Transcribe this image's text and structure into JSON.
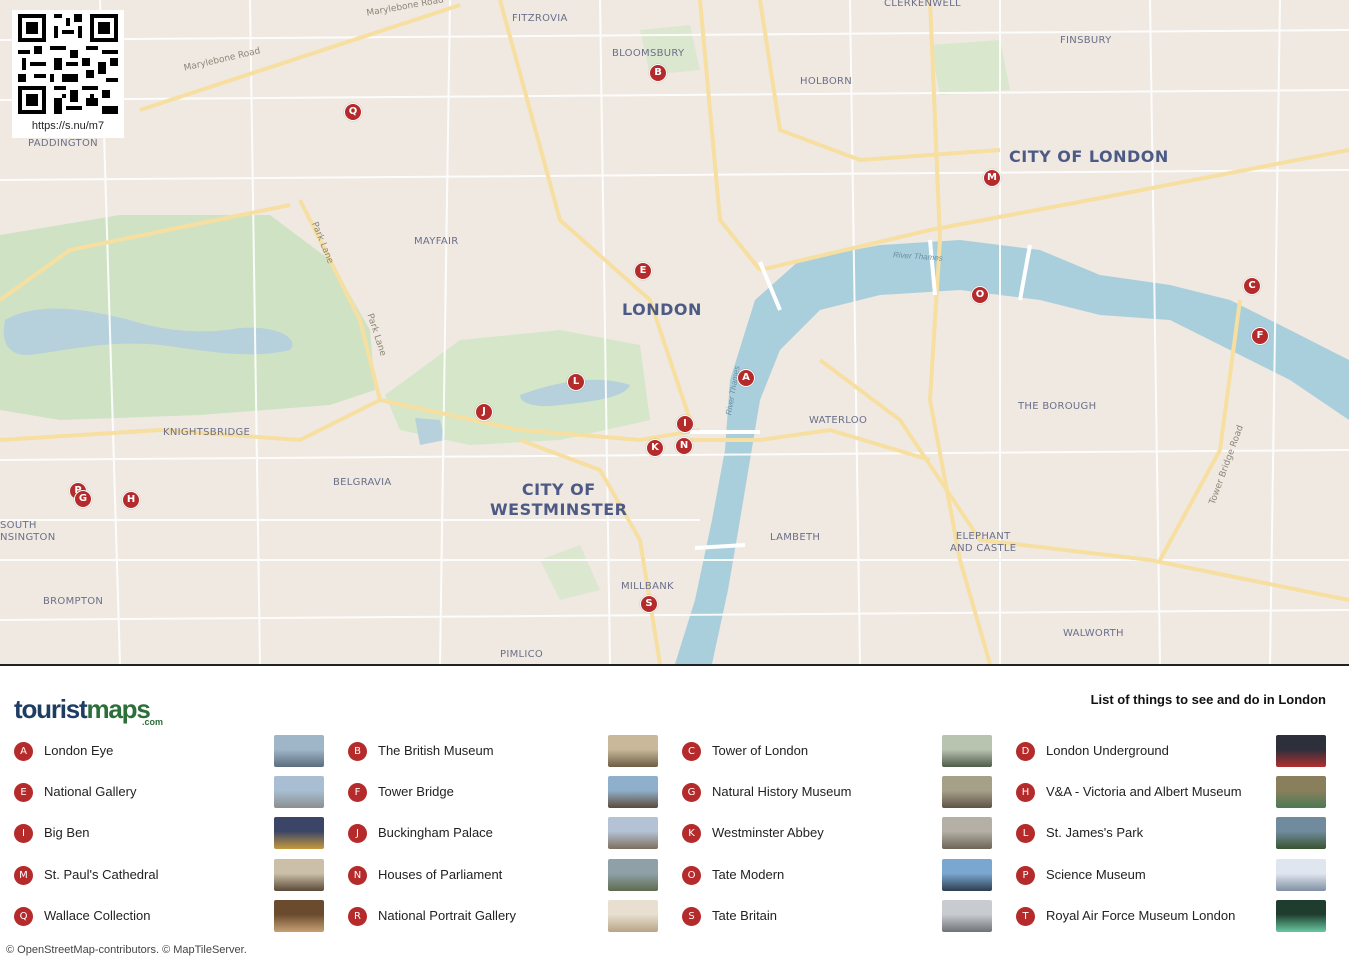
{
  "map": {
    "qr_url": "https://s.nu/m7",
    "area_labels": [
      {
        "id": "fitzrovia",
        "text": "FITZROVIA"
      },
      {
        "id": "clerkenwell",
        "text": "CLERKENWELL"
      },
      {
        "id": "finsbury",
        "text": "FINSBURY"
      },
      {
        "id": "bloomsbury",
        "text": "BLOOMSBURY"
      },
      {
        "id": "holborn",
        "text": "HOLBORN"
      },
      {
        "id": "paddington",
        "text": "PADDINGTON"
      },
      {
        "id": "mayfair",
        "text": "MAYFAIR"
      },
      {
        "id": "knightsbridge",
        "text": "KNIGHTSBRIDGE"
      },
      {
        "id": "belgravia",
        "text": "BELGRAVIA"
      },
      {
        "id": "waterloo",
        "text": "WATERLOO"
      },
      {
        "id": "the-borough",
        "text": "THE BOROUGH"
      },
      {
        "id": "lambeth",
        "text": "LAMBETH"
      },
      {
        "id": "millbank",
        "text": "MILLBANK"
      },
      {
        "id": "brompton",
        "text": "BROMPTON"
      },
      {
        "id": "pimlico",
        "text": "PIMLICO"
      },
      {
        "id": "walworth",
        "text": "WALWORTH"
      },
      {
        "id": "south-kensington",
        "text": "SOUTH\nNSINGTON"
      },
      {
        "id": "elephant-castle",
        "text": "ELEPHANT\nAND CASTLE"
      }
    ],
    "major_labels": [
      {
        "id": "london",
        "text": "LONDON"
      },
      {
        "id": "city-of-london",
        "text": "CITY OF LONDON"
      },
      {
        "id": "city-of-westminster",
        "text": "CITY OF\nWESTMINSTER"
      }
    ],
    "street_labels": [
      {
        "id": "marylebone-road-1",
        "text": "Marylebone Road"
      },
      {
        "id": "marylebone-road-2",
        "text": "Marylebone Road"
      },
      {
        "id": "park-lane-1",
        "text": "Park Lane"
      },
      {
        "id": "park-lane-2",
        "text": "Park Lane"
      },
      {
        "id": "tower-bridge-road",
        "text": "Tower Bridge Road"
      }
    ],
    "river_labels": [
      {
        "id": "river-thames-1",
        "text": "River Thames"
      },
      {
        "id": "river-thames-2",
        "text": "River Thames"
      }
    ],
    "pins": [
      "A",
      "B",
      "C",
      "E",
      "F",
      "G",
      "H",
      "I",
      "J",
      "K",
      "L",
      "M",
      "N",
      "O",
      "P",
      "Q",
      "S"
    ]
  },
  "legend": {
    "logo_part1": "tourist",
    "logo_part2": "maps",
    "logo_suffix": ".com",
    "title": "List of things to see and do in London",
    "items": [
      {
        "letter": "A",
        "name": "London Eye"
      },
      {
        "letter": "B",
        "name": "The British Museum"
      },
      {
        "letter": "C",
        "name": "Tower of London"
      },
      {
        "letter": "D",
        "name": "London Underground"
      },
      {
        "letter": "E",
        "name": "National Gallery"
      },
      {
        "letter": "F",
        "name": "Tower Bridge"
      },
      {
        "letter": "G",
        "name": "Natural History Museum"
      },
      {
        "letter": "H",
        "name": "V&A - Victoria and Albert Museum"
      },
      {
        "letter": "I",
        "name": "Big Ben"
      },
      {
        "letter": "J",
        "name": "Buckingham Palace"
      },
      {
        "letter": "K",
        "name": "Westminster Abbey"
      },
      {
        "letter": "L",
        "name": "St. James's Park"
      },
      {
        "letter": "M",
        "name": "St. Paul's Cathedral"
      },
      {
        "letter": "N",
        "name": "Houses of Parliament"
      },
      {
        "letter": "O",
        "name": "Tate Modern"
      },
      {
        "letter": "P",
        "name": "Science Museum"
      },
      {
        "letter": "Q",
        "name": "Wallace Collection"
      },
      {
        "letter": "R",
        "name": "National Portrait Gallery"
      },
      {
        "letter": "S",
        "name": "Tate Britain"
      },
      {
        "letter": "T",
        "name": "Royal Air Force Museum London"
      }
    ],
    "attribution": "© OpenStreetMap-contributors. © MapTileServer."
  }
}
